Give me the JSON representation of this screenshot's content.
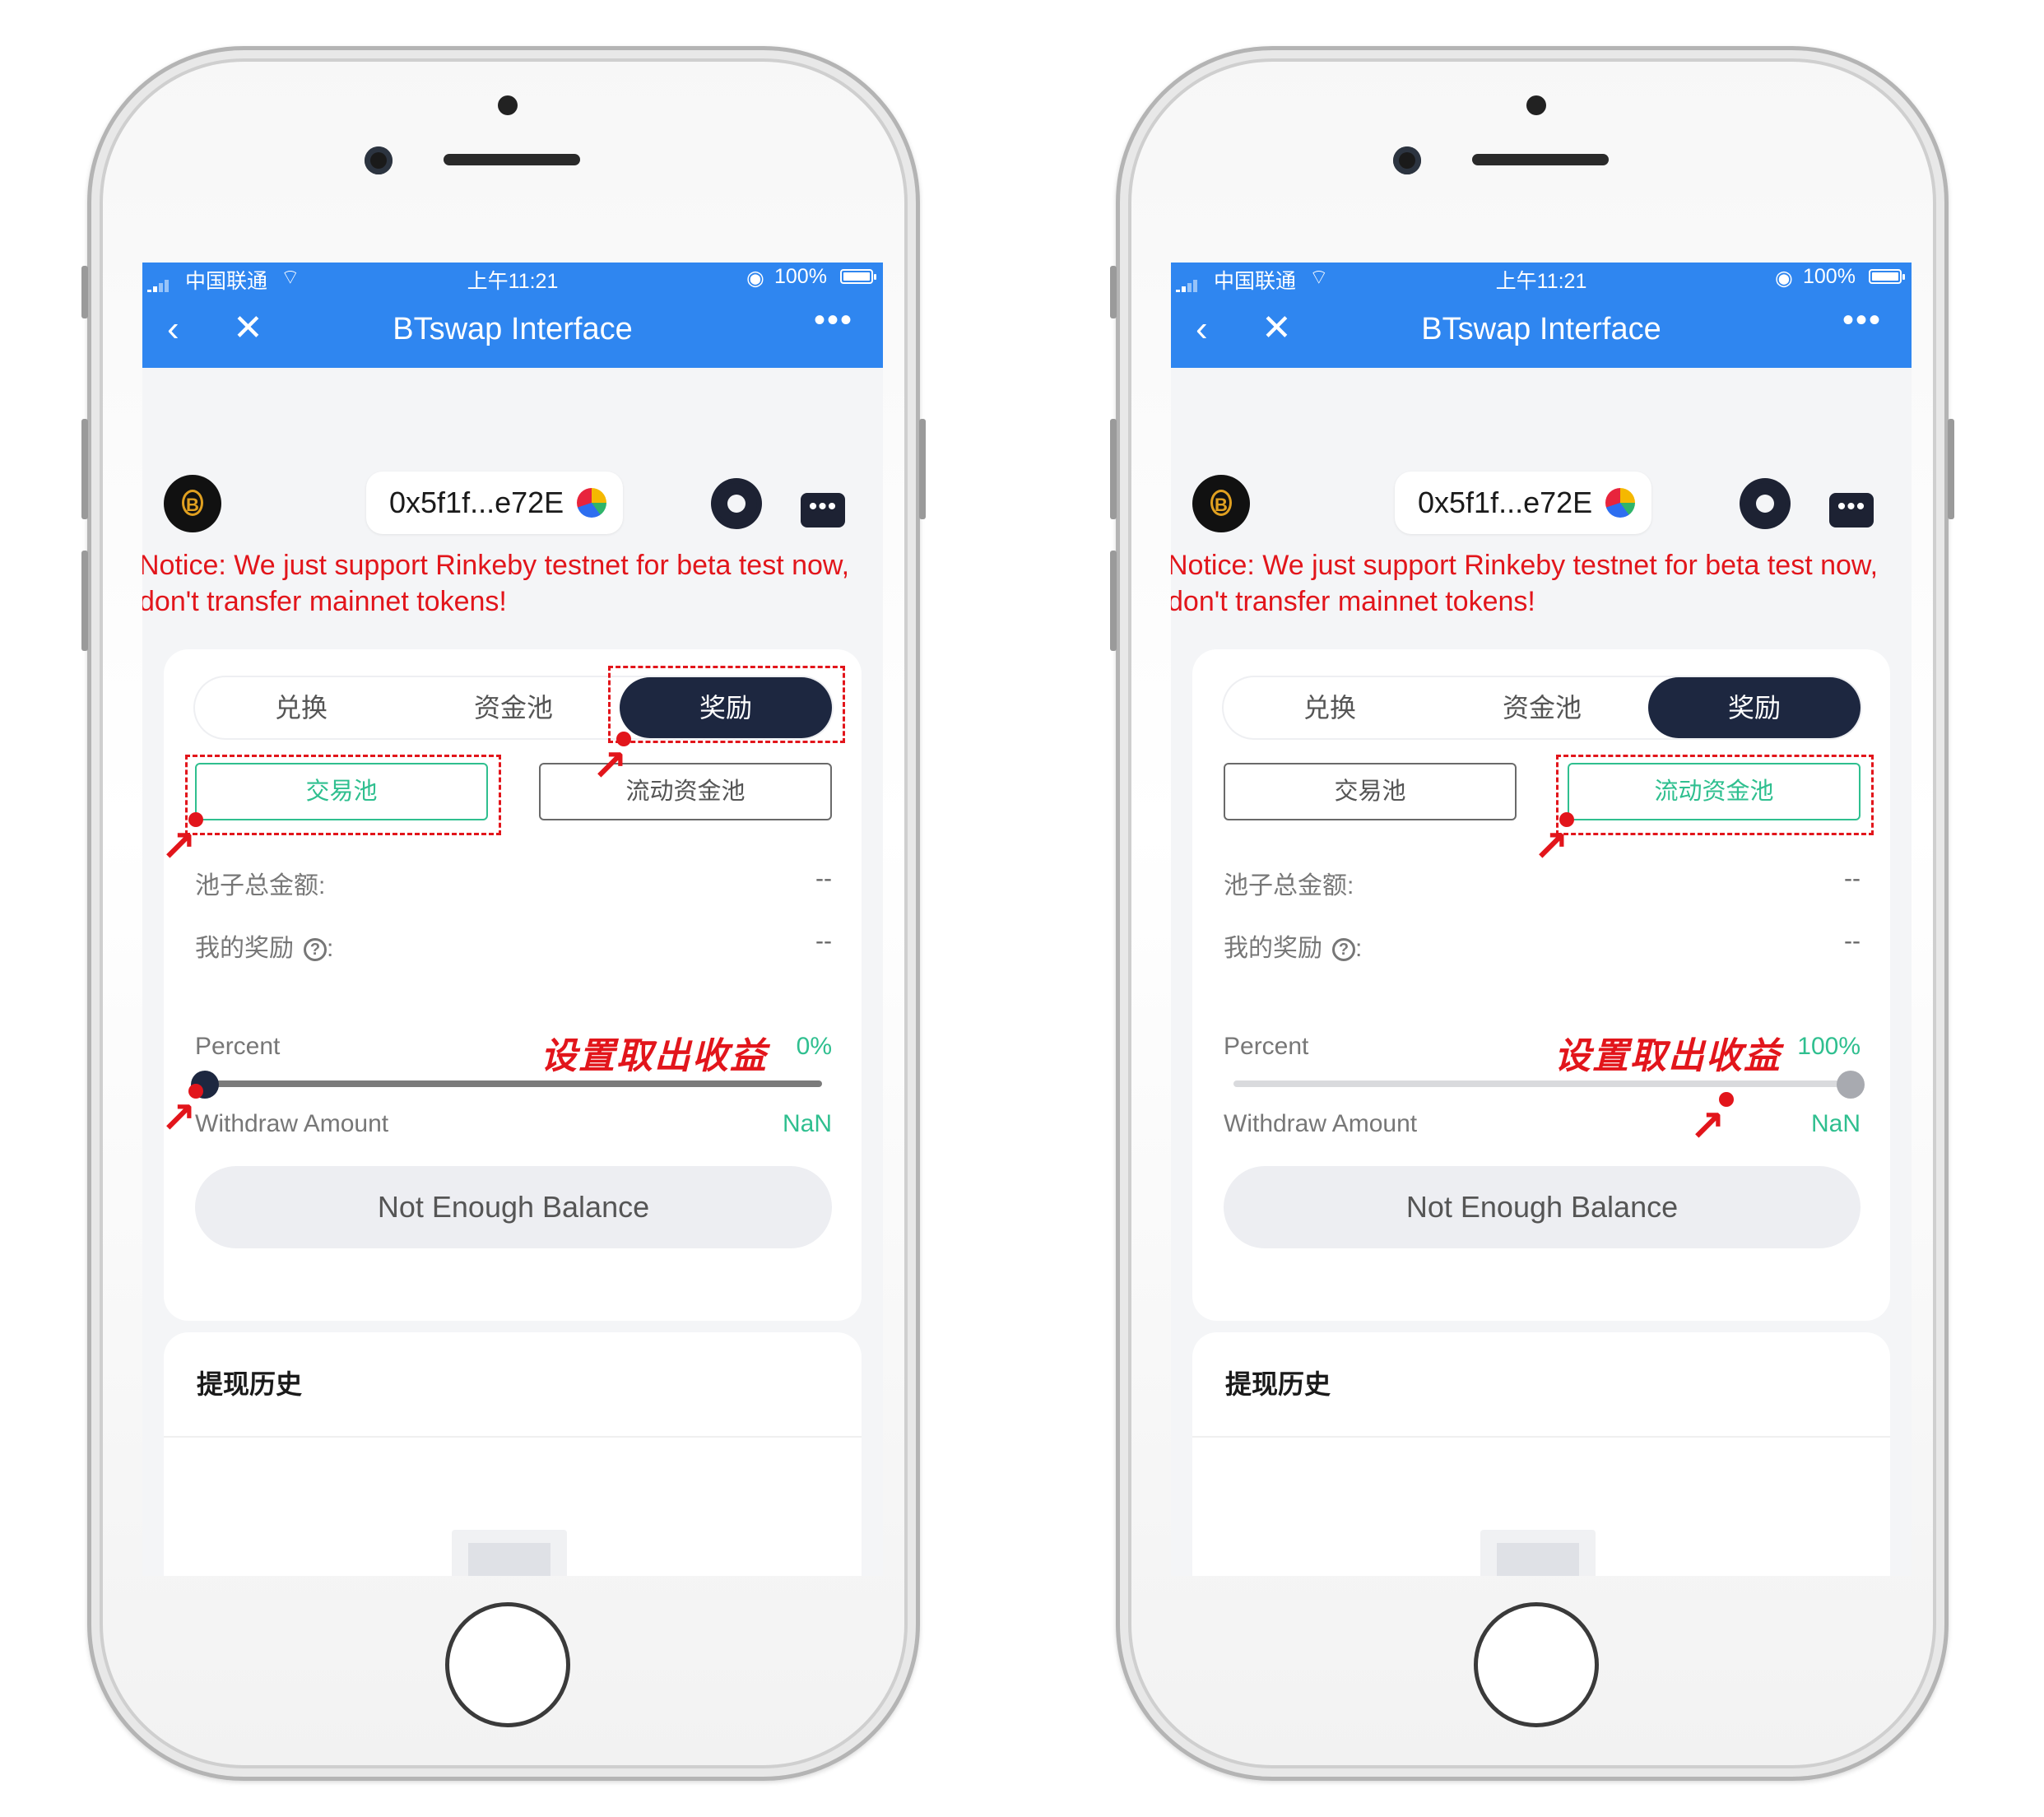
{
  "statusbar": {
    "carrier": "中国联通",
    "time": "上午11:21",
    "battery": "100%"
  },
  "nav": {
    "back": "‹",
    "close": "✕",
    "title": "BTswap Interface",
    "more": "•••"
  },
  "wallet": {
    "address": "0x5f1f...e72E"
  },
  "notice": "Notice: We just support Rinkeby testnet for beta test now, don't transfer mainnet tokens!",
  "tabs": [
    "兑换",
    "资金池",
    "奖励"
  ],
  "pools": [
    "交易池",
    "流动资金池"
  ],
  "pool_total_label": "池子总金额:",
  "pool_total_value": "--",
  "my_reward_label": "我的奖励",
  "my_reward_colon": ":",
  "my_reward_value": "--",
  "percent_label": "Percent",
  "withdraw_label": "Withdraw Amount",
  "withdraw_value": "NaN",
  "balance_button": "Not Enough Balance",
  "history_title": "提现历史",
  "annotation": "设置取出收益",
  "screens": [
    {
      "active_tab": "奖励",
      "active_pool": "交易池",
      "percent": "0%",
      "percent_fraction": 0.0
    },
    {
      "active_tab": "奖励",
      "active_pool": "流动资金池",
      "percent": "100%",
      "percent_fraction": 1.0
    }
  ],
  "colors": {
    "navbar": "#2f86f0",
    "accent_green": "#2fbf8f",
    "annotation_red": "#e2151b",
    "tab_active": "#1d2740"
  },
  "icons": [
    "back-icon",
    "close-icon",
    "more-icon",
    "logo-icon",
    "wallet-icon",
    "gear-icon",
    "menu-dots-icon",
    "help-icon",
    "empty-document-icon",
    "wifi-icon",
    "signal-icon",
    "battery-icon"
  ]
}
